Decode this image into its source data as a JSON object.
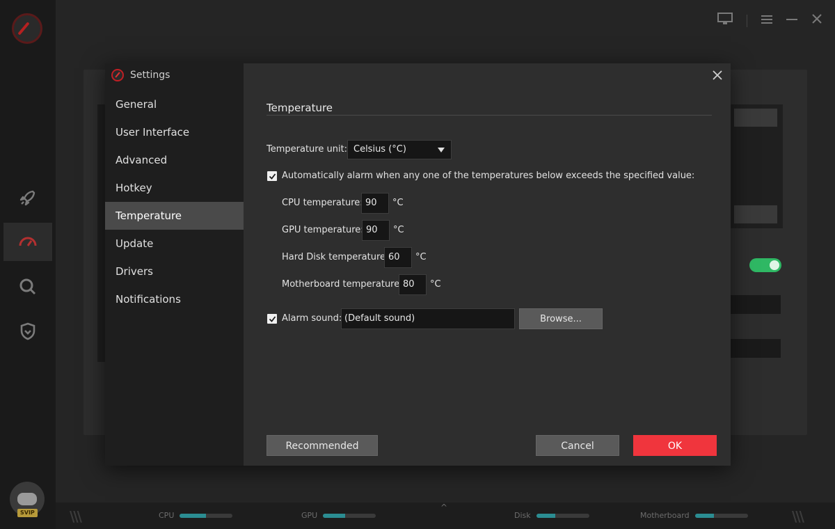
{
  "dialog": {
    "title": "Settings",
    "nav": [
      {
        "label": "General"
      },
      {
        "label": "User Interface"
      },
      {
        "label": "Advanced"
      },
      {
        "label": "Hotkey"
      },
      {
        "label": "Temperature"
      },
      {
        "label": "Update"
      },
      {
        "label": "Drivers"
      },
      {
        "label": "Notifications"
      }
    ],
    "active_nav": "Temperature",
    "close_icon": "close-icon"
  },
  "temperature": {
    "section_title": "Temperature",
    "unit_label": "Temperature unit:",
    "unit_value": "Celsius (°C)",
    "alarm_checked": true,
    "alarm_label": "Automatically alarm when any one of the temperatures below exceeds the specified value:",
    "cpu": {
      "label": "CPU temperature:",
      "value": "90",
      "unit": "°C"
    },
    "gpu": {
      "label": "GPU temperature:",
      "value": "90",
      "unit": "°C"
    },
    "disk": {
      "label": "Hard Disk temperature:",
      "value": "60",
      "unit": "°C"
    },
    "motherboard": {
      "label": "Motherboard temperature:",
      "value": "80",
      "unit": "°C"
    },
    "sound_checked": true,
    "sound_label": "Alarm sound:",
    "sound_value": "(Default sound)",
    "browse_label": "Browse..."
  },
  "footer": {
    "recommended_label": "Recommended",
    "cancel_label": "Cancel",
    "ok_label": "OK"
  },
  "statusbar": {
    "cpu": {
      "label": "CPU",
      "level": 0.5
    },
    "gpu": {
      "label": "GPU",
      "level": 0.42
    },
    "disk": {
      "label": "Disk",
      "level": 0.36
    },
    "motherboard": {
      "label": "Motherboard",
      "level": 0.36
    }
  },
  "colors": {
    "accent_red": "#f0353d",
    "toggle_green": "#2fb864",
    "meter_teal": "#2b8d92"
  }
}
